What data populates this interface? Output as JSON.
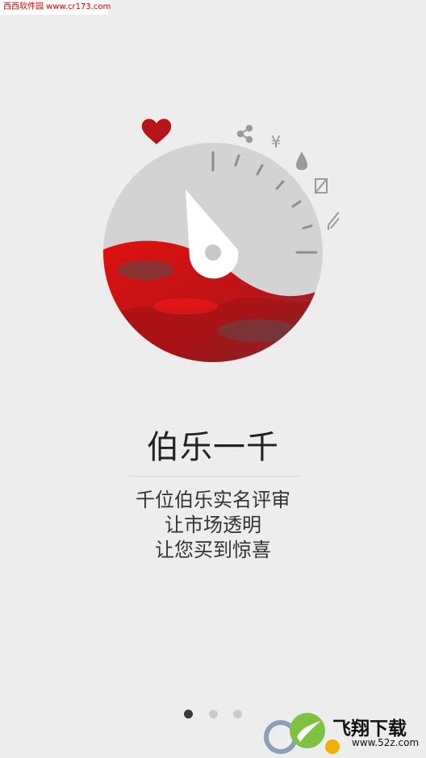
{
  "watermark": {
    "top_left_text": "西西软件园 www.cr173.com"
  },
  "dial": {
    "icons": [
      "heart-icon",
      "share-icon",
      "yen-icon",
      "drop-icon",
      "square-slash-icon",
      "pencil-icon"
    ]
  },
  "content": {
    "title": "伯乐一千",
    "lines": [
      "千位伯乐实名评审",
      "让市场透明",
      "让您买到惊喜"
    ]
  },
  "pager": {
    "count": 3,
    "active_index": 0
  },
  "corner_logo": {
    "text": "飞翔下载",
    "url": "www.52z.com"
  },
  "colors": {
    "background": "#ededed",
    "accent": "#d3161b",
    "dial": "#d2d2d2"
  }
}
